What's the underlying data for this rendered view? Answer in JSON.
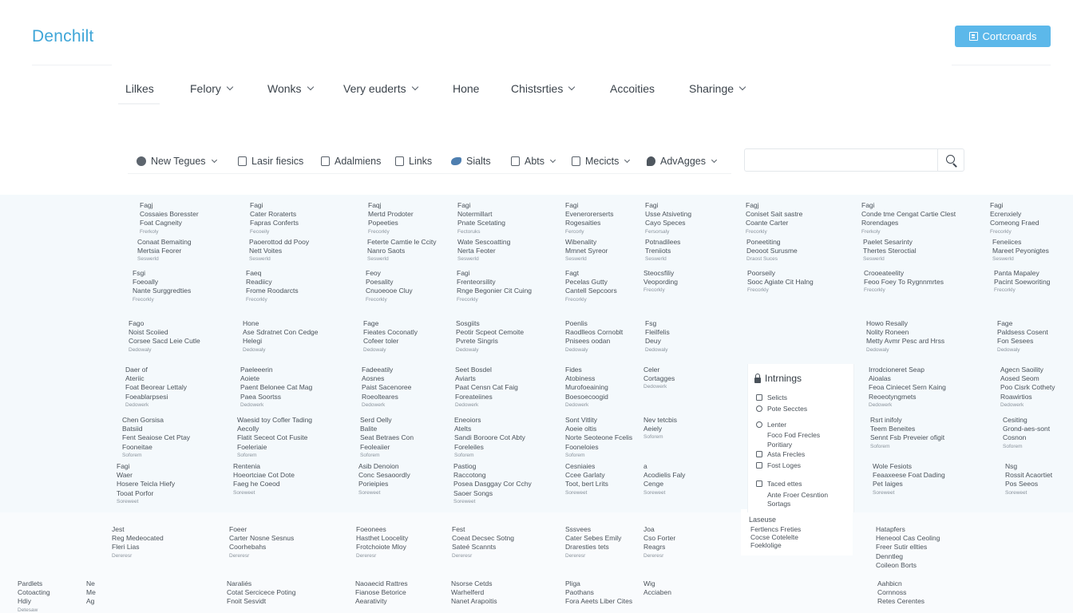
{
  "header": {
    "logo": "Denchilt",
    "cta_label": "Cortcroards"
  },
  "main_nav": {
    "items": [
      {
        "label": "Lilkes",
        "has_dropdown": false
      },
      {
        "label": "Felory",
        "has_dropdown": true
      },
      {
        "label": "Wonks",
        "has_dropdown": true
      },
      {
        "label": "Very euderts",
        "has_dropdown": true
      },
      {
        "label": "Hone",
        "has_dropdown": false
      },
      {
        "label": "Chistsrties",
        "has_dropdown": true
      },
      {
        "label": "Accoities",
        "has_dropdown": false
      },
      {
        "label": "Sharinge",
        "has_dropdown": true
      }
    ]
  },
  "sub_nav": {
    "items": [
      {
        "label": "New Tegues",
        "icon": "circle-icon",
        "has_dropdown": true
      },
      {
        "label": "Lasir fiesics",
        "icon": "document-icon",
        "has_dropdown": false
      },
      {
        "label": "Adalmiens",
        "icon": "file-icon",
        "has_dropdown": false
      },
      {
        "label": "Links",
        "icon": "folder-icon",
        "has_dropdown": false
      },
      {
        "label": "Sialts",
        "icon": "bird-icon",
        "has_dropdown": false
      },
      {
        "label": "Abts",
        "icon": "clipboard-icon",
        "has_dropdown": true
      },
      {
        "label": "Mecicts",
        "icon": "page-icon",
        "has_dropdown": true
      },
      {
        "label": "AdvAgges",
        "icon": "chat-icon",
        "has_dropdown": true
      }
    ]
  },
  "search": {
    "placeholder": "",
    "value": ""
  },
  "tiles_row1": [
    {
      "lines": [
        "Fagj",
        "Cossaies Boresster",
        "Foat Cagneity"
      ],
      "sub": "Frerkoly"
    },
    {
      "lines": [
        "Fagi",
        "Cater Roraterts",
        "Fapras Conferts"
      ],
      "sub": "Fecoeily"
    },
    {
      "lines": [
        "Faqj",
        "Mertd Prodoter",
        "Popeeties"
      ],
      "sub": "Frecorkly"
    },
    {
      "lines": [
        "Fagi",
        "Notermillart",
        "Pnate Scetating"
      ],
      "sub": "Fectoruks"
    },
    {
      "lines": [
        "Fagi",
        "Evenerorerserts",
        "Rogesaities"
      ],
      "sub": "Fercorly"
    },
    {
      "lines": [
        "Fagi",
        "Usse Atsiveting",
        "Cayo Speces"
      ],
      "sub": "Fersorsaly"
    },
    {
      "lines": [
        "Fagj",
        "Coniset Sait sastre",
        "Coante Carter"
      ],
      "sub": "Frecorkly"
    },
    {
      "lines": [
        "Fagi",
        "Conde tme Cengat Cartie Clest",
        "Rorendages"
      ],
      "sub": "Frerkoly"
    },
    {
      "lines": [
        "Fagi",
        "Ecrenxiely",
        "Comeong Fraed"
      ],
      "sub": "Frecorkly"
    }
  ],
  "tiles_row2": [
    {
      "lines": [
        "Conaat Bemaiting",
        "Mertsia Feorer"
      ],
      "sub": "Seswerld"
    },
    {
      "lines": [
        "Paoerottod dd Pooy",
        "Nett Voites"
      ],
      "sub": "Seswerld"
    },
    {
      "lines": [
        "Feterte Camtie le Ccity",
        "Nanro Saots"
      ],
      "sub": "Seswerld"
    },
    {
      "lines": [
        "Wate Sescoatting",
        "Nerta Feoter"
      ],
      "sub": "Seswerld"
    },
    {
      "lines": [
        "Wibenality",
        "Mmnet Syreor"
      ],
      "sub": "Seswerld"
    },
    {
      "lines": [
        "Potnadilees",
        "Treniiots"
      ],
      "sub": "Seswerld"
    },
    {
      "lines": [
        "Poneetiting",
        "Deooot Surusme"
      ],
      "sub": "Draost Suces"
    },
    {
      "lines": [
        "Paelet Sesarinty",
        "Thertes Steroctial"
      ],
      "sub": "Seswerld"
    },
    {
      "lines": [
        "Feneiices",
        "Mareet Peyonigtes"
      ],
      "sub": "Seswerld"
    }
  ],
  "tiles_row3": [
    {
      "lines": [
        "Fsgi",
        "Foeoally",
        "Nante Surggredties"
      ],
      "sub": "Frecorkly"
    },
    {
      "lines": [
        "Faeq",
        "Readiicy",
        "Frome Roodarcts"
      ],
      "sub": "Frecorkly"
    },
    {
      "lines": [
        "Feoy",
        "Poesality",
        "Cnuoeooe Cluy"
      ],
      "sub": "Frecorkly"
    },
    {
      "lines": [
        "Fagi",
        "Frenteorsility",
        "Rnge Begonier Cit Cuing"
      ],
      "sub": "Frecorkly"
    },
    {
      "lines": [
        "Fagt",
        "Pecelas Gutty",
        "Cantell Sepcoors"
      ],
      "sub": "Frecorkly"
    },
    {
      "lines": [
        "Steocsfiliy",
        "Veopording"
      ],
      "sub": "Frecorkly"
    },
    {
      "lines": [
        "Poorseily",
        "Sooc Agiate Cit Halng"
      ],
      "sub": "Frecorkly"
    },
    {
      "lines": [
        "Crooeateelity",
        "Feoo Foey To Rygnnmrtes"
      ],
      "sub": "Frecorkly"
    },
    {
      "lines": [
        "Panta Mapaley",
        "Pacint Soeworiting"
      ],
      "sub": "Frecorkly"
    }
  ],
  "tiles_row4": [
    {
      "lines": [
        "Fago",
        "Noist Scoiied",
        "Corsee Sacd Leie Cutle"
      ],
      "sub": "Dedowaly"
    },
    {
      "lines": [
        "Hone",
        "Ase Sdratnet Con Cedge",
        "Helegi"
      ],
      "sub": "Dedowaly"
    },
    {
      "lines": [
        "Fage",
        "Fieates Coconatly",
        "Cofeer toler"
      ],
      "sub": "Dedowaly"
    },
    {
      "lines": [
        "Sosgiits",
        "Peotir Scpeot Cemoite",
        "Pvrete Singris"
      ],
      "sub": "Dedowaly"
    },
    {
      "lines": [
        "Poenlis",
        "Raodlleos Cornoblt",
        "Pnisees oodan"
      ],
      "sub": "Dedowaly"
    },
    {
      "lines": [
        "Fsg",
        "Fleilfelis",
        "Deuy"
      ],
      "sub": "Dedowaly"
    },
    {
      "lines": [
        "Howo Resally",
        "Nolity Roneen",
        "Metty Avmr Pesc ard Hrss"
      ],
      "sub": "Dedowaly"
    },
    {
      "lines": [
        "Fage",
        "Paldsess Cosent",
        "Fon Sesees"
      ],
      "sub": "Dedowaly"
    }
  ],
  "callout": {
    "title": "Laseuse",
    "lines": [
      "Fertlencs Freties",
      "Cocse Cotelelte",
      "Foeklolige"
    ]
  },
  "tiles_row5": [
    {
      "lines": [
        "Daer of",
        "Ateriic",
        "Foat Beorear Lettaly",
        "Foeablarpsesi"
      ],
      "sub": "Dedowerk"
    },
    {
      "lines": [
        "Paeleeerin",
        "Aoiete",
        "Paent Belonee Cat Mag",
        "Paea Soortss"
      ],
      "sub": "Dedowerk"
    },
    {
      "lines": [
        "Fadeeatily",
        "Aosnes",
        "Paist Sacenoree",
        "Roeolteares"
      ],
      "sub": "Dedowerk"
    },
    {
      "lines": [
        "Seet Bosdel",
        "Aviarts",
        "Paat Censn Cat Faig",
        "Foreateiines"
      ],
      "sub": "Dedowerk"
    },
    {
      "lines": [
        "Fides",
        "Atobiness",
        "Murofoeaining",
        "Boesoecoogid"
      ],
      "sub": "Dedowerk"
    },
    {
      "lines": [
        "Celer",
        "Cortagges"
      ],
      "sub": "Dedowerk"
    },
    {
      "lines": [
        "Irrodcioneret Seap",
        "Aioalas",
        "Feoa Ciniecet Sern Kaing",
        "Reoeotyngmets"
      ],
      "sub": "Dedowerk"
    },
    {
      "lines": [
        "Agecn Saoility",
        "Aosed Seom",
        "Poo Cisrk Cothety",
        "Roawirtios"
      ],
      "sub": "Dedowerk"
    }
  ],
  "dropdown": {
    "title": "Intrnings",
    "items": [
      {
        "label": "Selicts",
        "sub": ""
      },
      {
        "label": "Pote Secctes",
        "sub": ""
      },
      {
        "label": "Lenter",
        "sub": "Foco Fod Frecles"
      },
      {
        "label": "Poritiary",
        "sub": ""
      },
      {
        "label": "Asta Frecles",
        "sub": ""
      },
      {
        "label": "Fost Loges",
        "sub": ""
      },
      {
        "label": "Taced ettes",
        "sub": "Ante Froer Cesntion"
      },
      {
        "label": "Sortags",
        "sub": ""
      }
    ]
  },
  "tiles_row6": [
    {
      "lines": [
        "Chen Gorsisa",
        "Batsiid",
        "Fent Seaiose Cet Ptay",
        "Fooneitae"
      ],
      "sub": "Soforem"
    },
    {
      "lines": [
        "Waesid toy Cofler Tading",
        "Aecolly",
        "Flatit Seceot Cot Fusite",
        "Foeleriaie"
      ],
      "sub": "Soforem"
    },
    {
      "lines": [
        "Serd Oelly",
        "Balite",
        "Seat Betraes Con",
        "Feoleaiier"
      ],
      "sub": "Soforem"
    },
    {
      "lines": [
        "Eneoiors",
        "Atelts",
        "Sandi Boroore Cot Abty",
        "Foreleiles"
      ],
      "sub": "Soforem"
    },
    {
      "lines": [
        "Sont Vitlity",
        "Aoeie oltis",
        "Norte Seoteone Fcelis",
        "Fooneloies"
      ],
      "sub": "Soforem"
    },
    {
      "lines": [
        "Nev tetcbis",
        "Aeiely"
      ],
      "sub": "Soforem"
    },
    {
      "lines": [
        "Rsrt inifoly",
        "Teem Beneites",
        "Sennt Fsb Preveier ofigit"
      ],
      "sub": "Soforem"
    },
    {
      "lines": [
        "Cesiting",
        "Grond-aes-sont",
        "Cosnon"
      ],
      "sub": "Soforem"
    }
  ],
  "tiles_row7": [
    {
      "lines": [
        "Fagi",
        "Waer",
        "Hosere Teicla Hiefy",
        "Tooat Porfor"
      ],
      "sub": "Soreweet"
    },
    {
      "lines": [
        "Rentenia",
        "Hoeortciae Cot Dote",
        "Faeg he Coeod"
      ],
      "sub": "Soreweet"
    },
    {
      "lines": [
        "Asib Denoion",
        "Conc Sesaoordly",
        "Porieipies"
      ],
      "sub": "Soreweet"
    },
    {
      "lines": [
        "Pastiog",
        "Raccotong",
        "Posea Dasggay Cor Cchy",
        "Saoer Songs"
      ],
      "sub": "Soreweet"
    },
    {
      "lines": [
        "Cesniaies",
        "Ccee Garlaty",
        "Toot, bert Lrits"
      ],
      "sub": "Soreweet"
    },
    {
      "lines": [
        "a",
        "Acodielis Faly",
        "Cenge"
      ],
      "sub": "Soreweet"
    },
    {
      "lines": [
        "Wole Fesiots",
        "Feaaxeese Foat Dading",
        "Pet Iaiges"
      ],
      "sub": "Soreweet"
    },
    {
      "lines": [
        "Nsg",
        "Rossit Acaortiet",
        "Pos Seeos"
      ],
      "sub": "Soreweet"
    }
  ],
  "tiles_row8": [
    {
      "lines": [
        "Jest",
        "Reg Medeocated",
        "Fleri Lias"
      ],
      "sub": "Dereresr"
    },
    {
      "lines": [
        "Foeer",
        "Carter Nosne Sesnus",
        "Coorhebahs"
      ],
      "sub": "Dereresr"
    },
    {
      "lines": [
        "Foeonees",
        "Hasthet Loocelity",
        "Frotchoiote Mloy"
      ],
      "sub": "Dereresr"
    },
    {
      "lines": [
        "Fest",
        "Coeat Decsec Sotng",
        "Sateé Scannts"
      ],
      "sub": "Dereresr"
    },
    {
      "lines": [
        "Sssvees",
        "Cater Sebes Emily",
        "Draresties tets"
      ],
      "sub": "Dereresr"
    },
    {
      "lines": [
        "Joa",
        "Cso Forter",
        "Reagrs"
      ],
      "sub": "Dereresr"
    },
    {
      "lines": [
        "Hatapfers",
        "Heneool Cas Ceoling",
        "Freer Sutir ellties",
        "Denntleg",
        "Coileon Borts"
      ],
      "sub": ""
    }
  ],
  "tiles_row9": [
    {
      "lines": [
        "Pardlets",
        "Cotoacting",
        "Hdiy"
      ],
      "sub": "Detesaw"
    },
    {
      "lines": [
        "Ne",
        "Me",
        "Ag"
      ],
      "sub": ""
    },
    {
      "lines": [
        "Naraliés",
        "Cotat Sercicece Poting",
        "Fnoit Sesvidt"
      ],
      "sub": ""
    },
    {
      "lines": [
        "Naoaecid Rattres",
        "Fianose Betorice",
        "Aearativity"
      ],
      "sub": ""
    },
    {
      "lines": [
        "Nsorse Cetds",
        "Warhelferd",
        "Nanet Arapoitis"
      ],
      "sub": ""
    },
    {
      "lines": [
        "Pliga",
        "Paothans",
        "Fora Aeets Liber Cites"
      ],
      "sub": ""
    },
    {
      "lines": [
        "Wig",
        "Acciaben"
      ],
      "sub": ""
    },
    {
      "lines": [
        "Aahbicn",
        "Cornnoss",
        "Retes Cerentes"
      ],
      "sub": ""
    }
  ]
}
